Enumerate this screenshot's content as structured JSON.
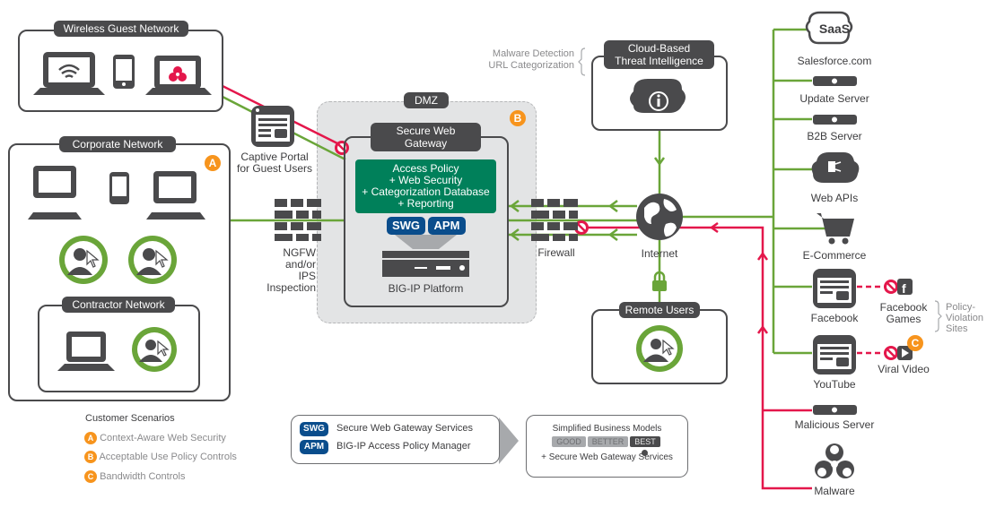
{
  "colors": {
    "green": "#6aa539",
    "red": "#e4174b",
    "dark": "#4a4a4c",
    "orange": "#f7941d",
    "policy_green": "#00805a",
    "blue": "#0a4d8c"
  },
  "wireless": {
    "title": "Wireless Guest Network"
  },
  "captive": {
    "line1": "Captive Portal",
    "line2": "for Guest Users"
  },
  "corporate": {
    "title": "Corporate Network",
    "badge": "A"
  },
  "contractor": {
    "title": "Contractor Network"
  },
  "ngfw": {
    "lines": [
      "NGFW",
      "and/or",
      "IPS",
      "Inspection"
    ]
  },
  "dmz": {
    "title": "DMZ",
    "badge": "B"
  },
  "swg": {
    "title_line1": "Secure Web",
    "title_line2": "Gateway",
    "policy": [
      "Access Policy",
      "+ Web Security",
      "+ Categorization Database",
      "+ Reporting"
    ],
    "tag1": "SWG",
    "tag2": "APM",
    "platform": "BIG-IP Platform"
  },
  "firewall": {
    "label": "Firewall"
  },
  "internet": {
    "label": "Internet"
  },
  "threat": {
    "title_line1": "Cloud-Based",
    "title_line2": "Threat Intelligence",
    "note1": "Malware Detection",
    "note2": "URL Categorization"
  },
  "remote": {
    "title": "Remote Users"
  },
  "right": {
    "saas_icon": "SaaS",
    "items": [
      "Salesforce.com",
      "Update Server",
      "B2B Server",
      "Web APIs",
      "E-Commerce",
      "Facebook",
      "YouTube",
      "Malicious Server",
      "Malware"
    ],
    "fb_games1": "Facebook",
    "fb_games2": "Games",
    "viral": "Viral Video",
    "badge_c": "C",
    "policy1": "Policy-",
    "policy2": "Violation",
    "policy3": "Sites"
  },
  "legend": {
    "title": "Customer Scenarios",
    "items": [
      {
        "badge": "A",
        "text": "Context-Aware Web Security"
      },
      {
        "badge": "B",
        "text": "Acceptable Use Policy Controls"
      },
      {
        "badge": "C",
        "text": "Bandwidth Controls"
      }
    ],
    "swg_tag": "SWG",
    "swg_text": "Secure Web Gateway Services",
    "apm_tag": "APM",
    "apm_text": "BIG-IP Access Policy Manager",
    "models_title": "Simplified Business Models",
    "tiers": [
      "GOOD",
      "BETTER",
      "BEST"
    ],
    "models_footer": "+ Secure Web Gateway Services"
  }
}
